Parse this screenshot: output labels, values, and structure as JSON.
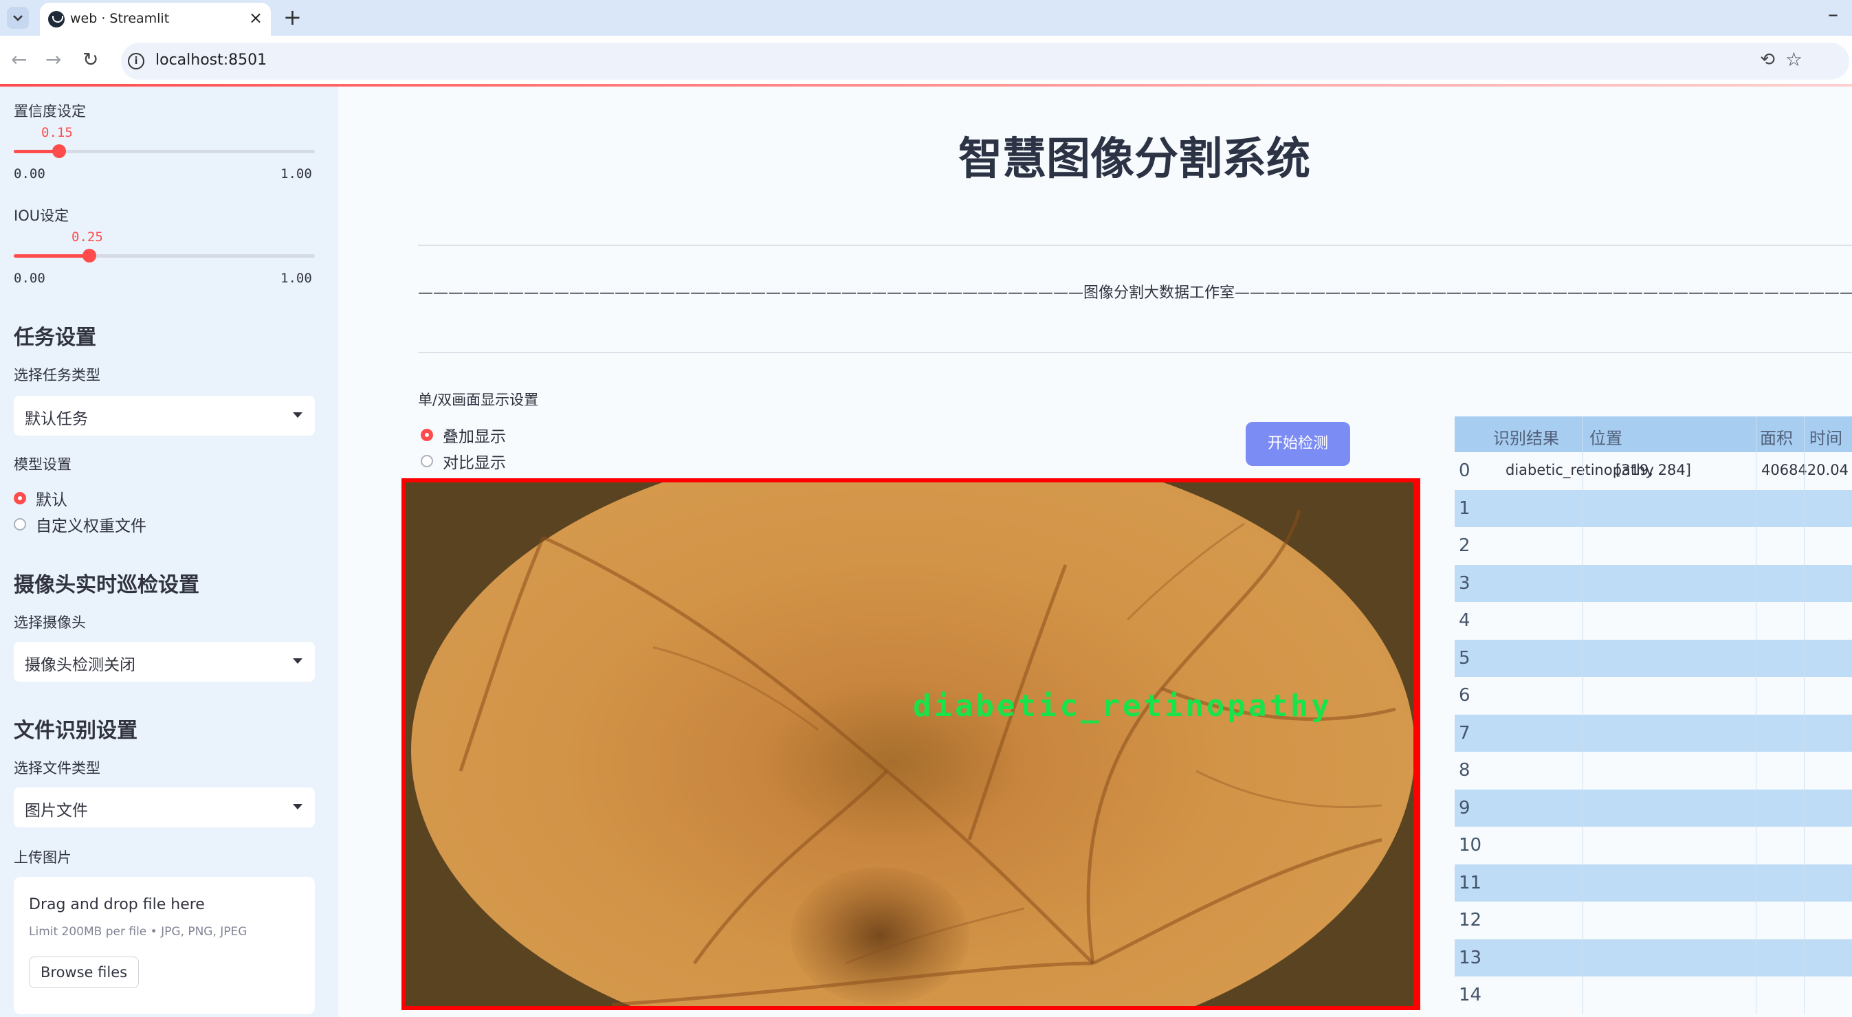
{
  "browser": {
    "tab_title": "web · Streamlit",
    "url": "localhost:8501",
    "new_tab": "+",
    "close": "×",
    "minimize": "–"
  },
  "sidebar": {
    "confidence": {
      "label": "置信度设定",
      "value": "0.15",
      "value_fraction": 0.15,
      "min": "0.00",
      "max": "1.00"
    },
    "iou": {
      "label": "IOU设定",
      "value": "0.25",
      "value_fraction": 0.25,
      "min": "0.00",
      "max": "1.00"
    },
    "task_heading": "任务设置",
    "task_type_label": "选择任务类型",
    "task_type_value": "默认任务",
    "model_label": "模型设置",
    "model_options": [
      "默认",
      "自定义权重文件"
    ],
    "model_selected": 0,
    "camera_heading": "摄像头实时巡检设置",
    "camera_label": "选择摄像头",
    "camera_value": "摄像头检测关闭",
    "file_heading": "文件识别设置",
    "file_type_label": "选择文件类型",
    "file_type_value": "图片文件",
    "upload_label": "上传图片",
    "uploader_title": "Drag and drop file here",
    "uploader_limit": "Limit 200MB per file • JPG, PNG, JPEG",
    "browse_button": "Browse files"
  },
  "main": {
    "title": "智慧图像分割系统",
    "studio_line": "————————————————————————————————————————————图像分割大数据工作室———————————————————————————————————————————",
    "display_label": "单/双画面显示设置",
    "display_options": [
      "叠加显示",
      "对比显示"
    ],
    "display_selected": 0,
    "detect_button": "开始检测",
    "detection_label": "diabetic_retinopathy"
  },
  "table": {
    "headers": [
      "识别结果",
      "位置",
      "面积",
      "时间"
    ],
    "rows": [
      {
        "idx": "0",
        "result": "diabetic_retinopathy",
        "position": "[319, 284]",
        "area": "4068420.04"
      },
      {
        "idx": "1"
      },
      {
        "idx": "2"
      },
      {
        "idx": "3"
      },
      {
        "idx": "4"
      },
      {
        "idx": "5"
      },
      {
        "idx": "6"
      },
      {
        "idx": "7"
      },
      {
        "idx": "8"
      },
      {
        "idx": "9"
      },
      {
        "idx": "10"
      },
      {
        "idx": "11"
      },
      {
        "idx": "12"
      },
      {
        "idx": "13"
      },
      {
        "idx": "14"
      }
    ]
  },
  "colors": {
    "accent": "#ff4b4b",
    "button": "#7c8cf5",
    "detection": "#17e34a",
    "frame": "#fe0000"
  }
}
